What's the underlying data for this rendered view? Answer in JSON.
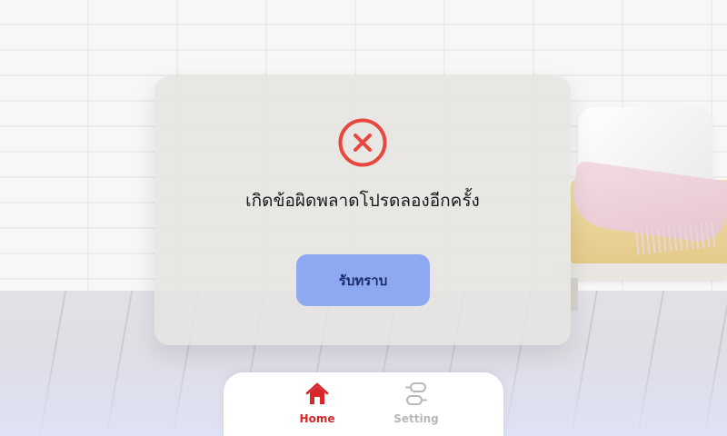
{
  "dialog": {
    "icon": "error-x-circle-icon",
    "message": "เกิดข้อผิดพลาดโปรดลองอีกครั้ง",
    "ok_label": "รับทราบ"
  },
  "nav": {
    "items": [
      {
        "label": "Home",
        "icon": "home-icon",
        "active": true
      },
      {
        "label": "Setting",
        "icon": "settings-toggle-icon",
        "active": false
      }
    ]
  },
  "colors": {
    "error_red": "#e8473f",
    "button_blue": "#8fa8f2",
    "active_red": "#d8262b",
    "inactive_gray": "#b8b8b8"
  }
}
